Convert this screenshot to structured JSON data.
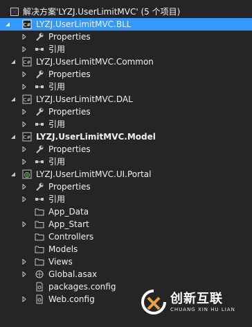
{
  "solution": {
    "label": "解决方案'LYZJ.UserLimitMVC' (5 个项目)"
  },
  "projects": [
    {
      "label": "LYZJ.UserLimitMVC.BLL",
      "properties": "Properties",
      "references": "引用"
    },
    {
      "label": "LYZJ.UserLimitMVC.Common",
      "properties": "Properties",
      "references": "引用"
    },
    {
      "label": "LYZJ.UserLimitMVC.DAL",
      "properties": "Properties",
      "references": "引用"
    },
    {
      "label": "LYZJ.UserLimitMVC.Model",
      "properties": "Properties",
      "references": "引用"
    },
    {
      "label": "LYZJ.UserLimitMVC.UI.Portal",
      "properties": "Properties",
      "references": "引用",
      "items": [
        "App_Data",
        "App_Start",
        "Controllers",
        "Models",
        "Views",
        "Global.asax",
        "packages.config",
        "Web.config"
      ]
    }
  ],
  "watermark": {
    "main": "创新互联",
    "sub": "CHUANG XIN HU LIAN"
  },
  "colors": {
    "selection": "#3399ff",
    "background": "#252526"
  }
}
